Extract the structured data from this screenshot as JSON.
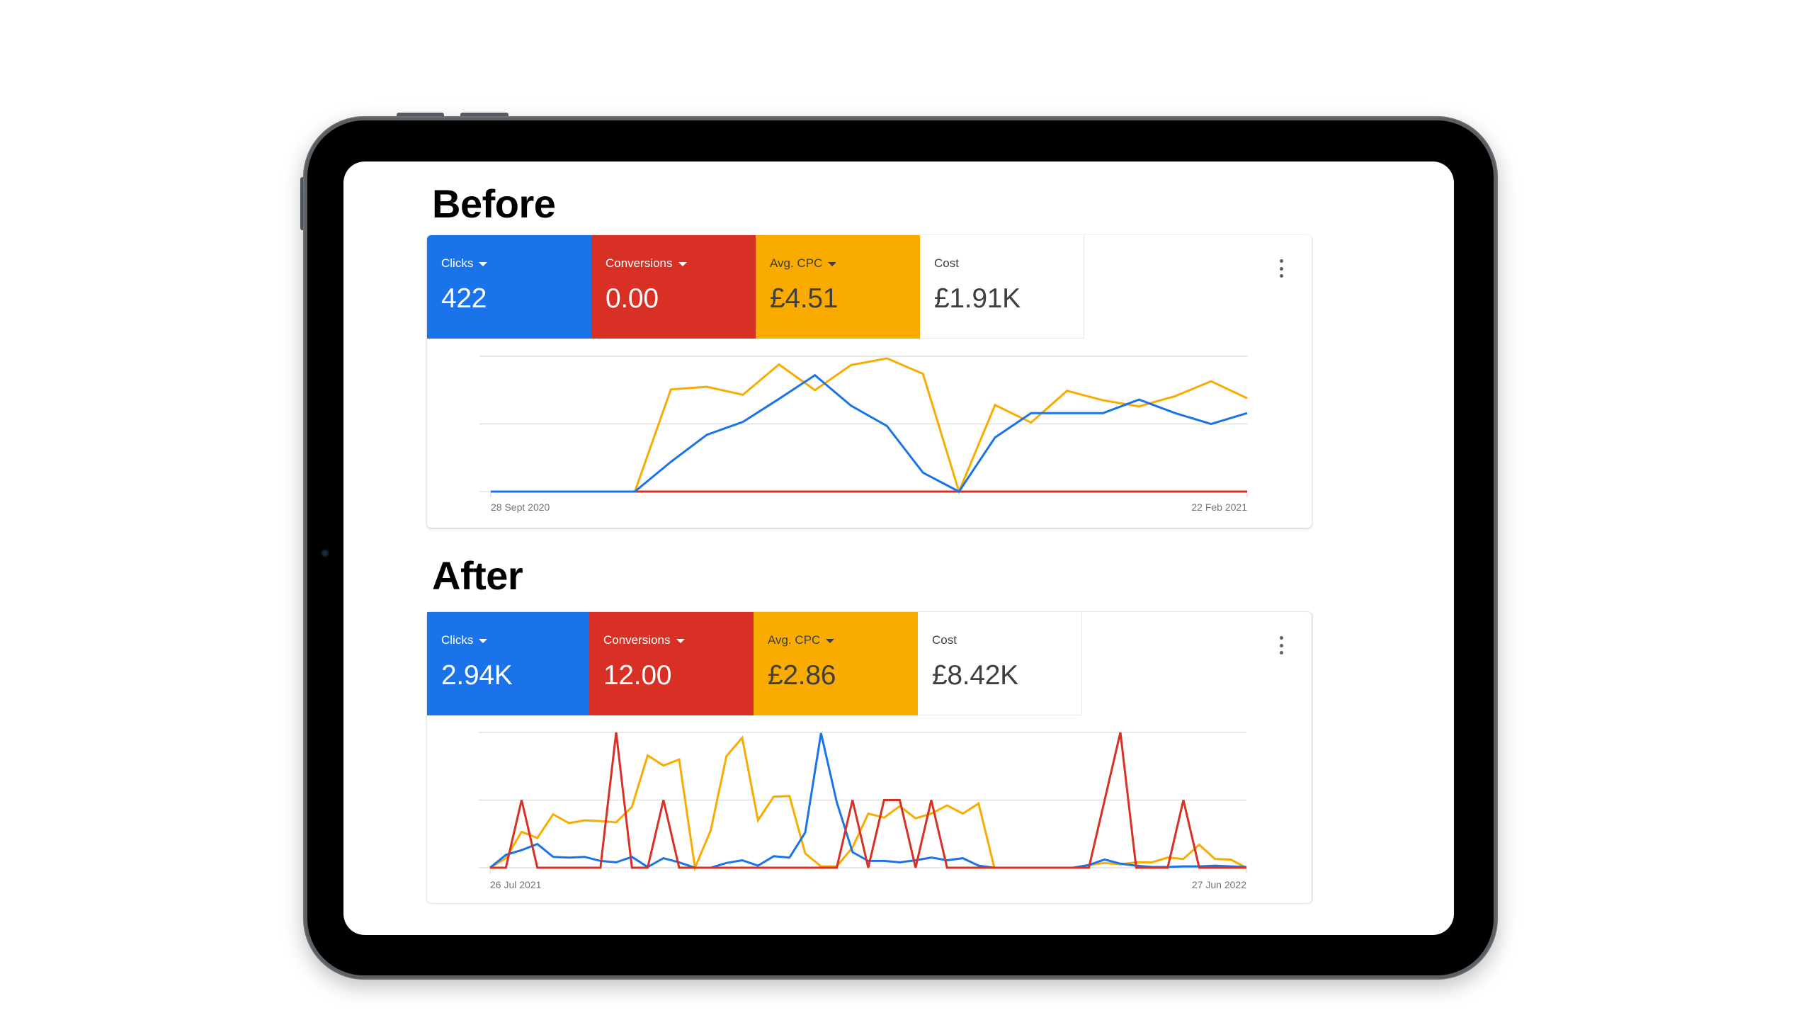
{
  "colors": {
    "clicks": "#1a73e8",
    "conversions": "#d93025",
    "avg_cpc": "#f9ab00",
    "cost_bg": "#ffffff",
    "label_dark": "#3c4043",
    "gridline": "#e0e0e0"
  },
  "sections": [
    {
      "title": "Before",
      "metrics": [
        {
          "label": "Clicks",
          "value": "422",
          "dropdown": true
        },
        {
          "label": "Conversions",
          "value": "0.00",
          "dropdown": true
        },
        {
          "label": "Avg. CPC",
          "value": "£4.51",
          "dropdown": true
        },
        {
          "label": "Cost",
          "value": "£1.91K",
          "dropdown": false
        }
      ],
      "menu_icon": "more-vert-icon"
    },
    {
      "title": "After",
      "metrics": [
        {
          "label": "Clicks",
          "value": "2.94K",
          "dropdown": true
        },
        {
          "label": "Conversions",
          "value": "12.00",
          "dropdown": true
        },
        {
          "label": "Avg. CPC",
          "value": "£2.86",
          "dropdown": true
        },
        {
          "label": "Cost",
          "value": "£8.42K",
          "dropdown": false
        }
      ],
      "menu_icon": "more-vert-icon"
    }
  ],
  "chart_data": [
    {
      "type": "line",
      "title": "Before",
      "x_start_label": "28 Sept 2020",
      "x_end_label": "22 Feb 2021",
      "y_units": "relative (gridline units, 0–2)",
      "ylim": [
        0,
        2
      ],
      "grid": true,
      "gridlines": [
        0,
        1,
        2
      ],
      "series": [
        {
          "name": "Clicks",
          "color": "#1a73e8",
          "values": [
            0,
            0,
            0,
            0,
            0,
            0.44,
            0.84,
            1.03,
            1.37,
            1.72,
            1.27,
            0.97,
            0.28,
            0,
            0.8,
            1.16,
            1.16,
            1.16,
            1.36,
            1.16,
            1.0,
            1.16
          ]
        },
        {
          "name": "Conversions",
          "color": "#d93025",
          "values": [
            0,
            0,
            0,
            0,
            0,
            0,
            0,
            0,
            0,
            0,
            0,
            0,
            0,
            0,
            0,
            0,
            0,
            0,
            0,
            0,
            0,
            0
          ]
        },
        {
          "name": "Avg. CPC",
          "color": "#f9ab00",
          "values": [
            0,
            0,
            0,
            0,
            0,
            1.51,
            1.55,
            1.43,
            1.88,
            1.5,
            1.87,
            1.97,
            1.74,
            0,
            1.28,
            1.02,
            1.49,
            1.35,
            1.26,
            1.41,
            1.63,
            1.38
          ]
        }
      ]
    },
    {
      "type": "line",
      "title": "After",
      "x_start_label": "26 Jul 2021",
      "x_end_label": "27 Jun 2022",
      "y_units": "relative (gridline units, 0–2)",
      "ylim": [
        0,
        2
      ],
      "grid": true,
      "gridlines": [
        0,
        1,
        2
      ],
      "series": [
        {
          "name": "Clicks",
          "color": "#1a73e8",
          "values": [
            0,
            0.19,
            0.26,
            0.35,
            0.16,
            0.15,
            0.16,
            0.1,
            0.08,
            0.16,
            0.01,
            0.14,
            0.08,
            0,
            0,
            0.07,
            0.11,
            0.03,
            0.17,
            0.15,
            0.52,
            1.99,
            0.97,
            0.23,
            0.1,
            0.1,
            0.08,
            0.11,
            0.15,
            0.11,
            0.14,
            0.03,
            0,
            0,
            0,
            0,
            0,
            0,
            0.04,
            0.12,
            0.06,
            0.03,
            0.01,
            0.01,
            0.02,
            0.02,
            0.03,
            0.02,
            0.01
          ]
        },
        {
          "name": "Conversions",
          "color": "#d93025",
          "values": [
            0,
            0,
            1,
            0,
            0,
            0,
            0,
            0,
            2,
            0,
            0,
            1,
            0,
            0,
            0,
            0,
            0,
            0,
            0,
            0,
            0,
            0,
            0,
            1,
            0,
            1,
            1,
            0,
            1,
            0,
            0,
            0,
            0,
            0,
            0,
            0,
            0,
            0,
            0,
            1,
            2,
            0,
            0,
            0,
            1,
            0,
            0,
            0,
            0
          ]
        },
        {
          "name": "Avg. CPC",
          "color": "#f9ab00",
          "values": [
            0,
            0.14,
            0.53,
            0.44,
            0.79,
            0.66,
            0.7,
            0.69,
            0.67,
            0.9,
            1.66,
            1.51,
            1.6,
            0,
            0.55,
            1.65,
            1.92,
            0.7,
            1.05,
            1.06,
            0.21,
            0.02,
            0.02,
            0.3,
            0.8,
            0.74,
            0.91,
            0.73,
            0.8,
            0.92,
            0.8,
            0.95,
            0,
            0,
            0,
            0,
            0,
            0,
            0.04,
            0.07,
            0.05,
            0.08,
            0.08,
            0.15,
            0.13,
            0.34,
            0.13,
            0.12,
            0
          ]
        }
      ]
    }
  ]
}
